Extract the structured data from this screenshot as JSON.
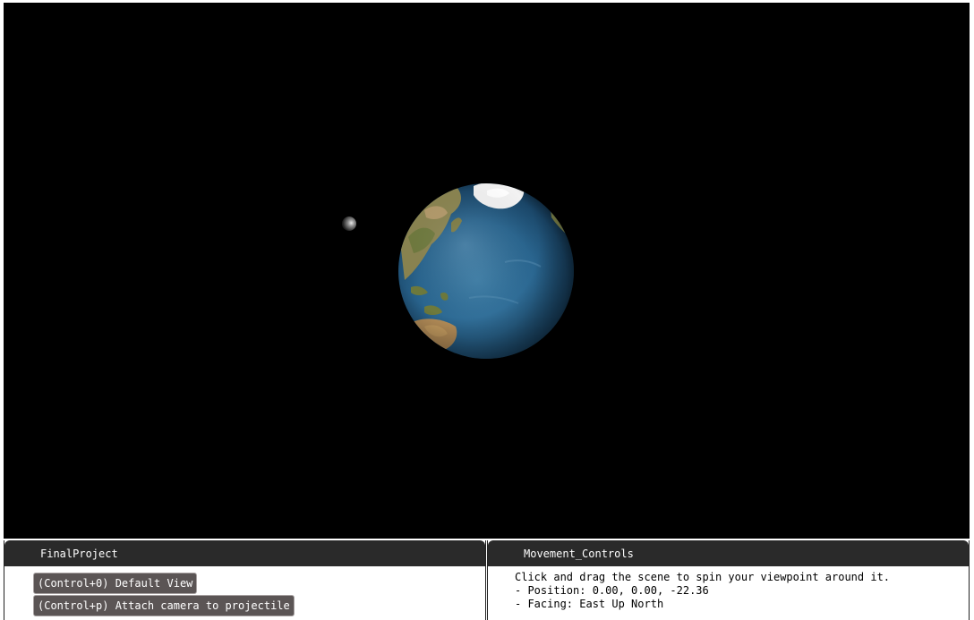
{
  "scene": {
    "background_color": "#000000",
    "objects": [
      "earth-planet",
      "moon-projectile"
    ]
  },
  "left_panel": {
    "title": "FinalProject",
    "buttons": [
      {
        "label": "(Control+0) Default View"
      },
      {
        "label": "(Control+p) Attach camera to projectile"
      }
    ]
  },
  "right_panel": {
    "title": "Movement_Controls",
    "lines": [
      "Click and drag the scene to spin your viewpoint around it.",
      "- Position: 0.00, 0.00, -22.36",
      "- Facing: East Up North"
    ]
  }
}
